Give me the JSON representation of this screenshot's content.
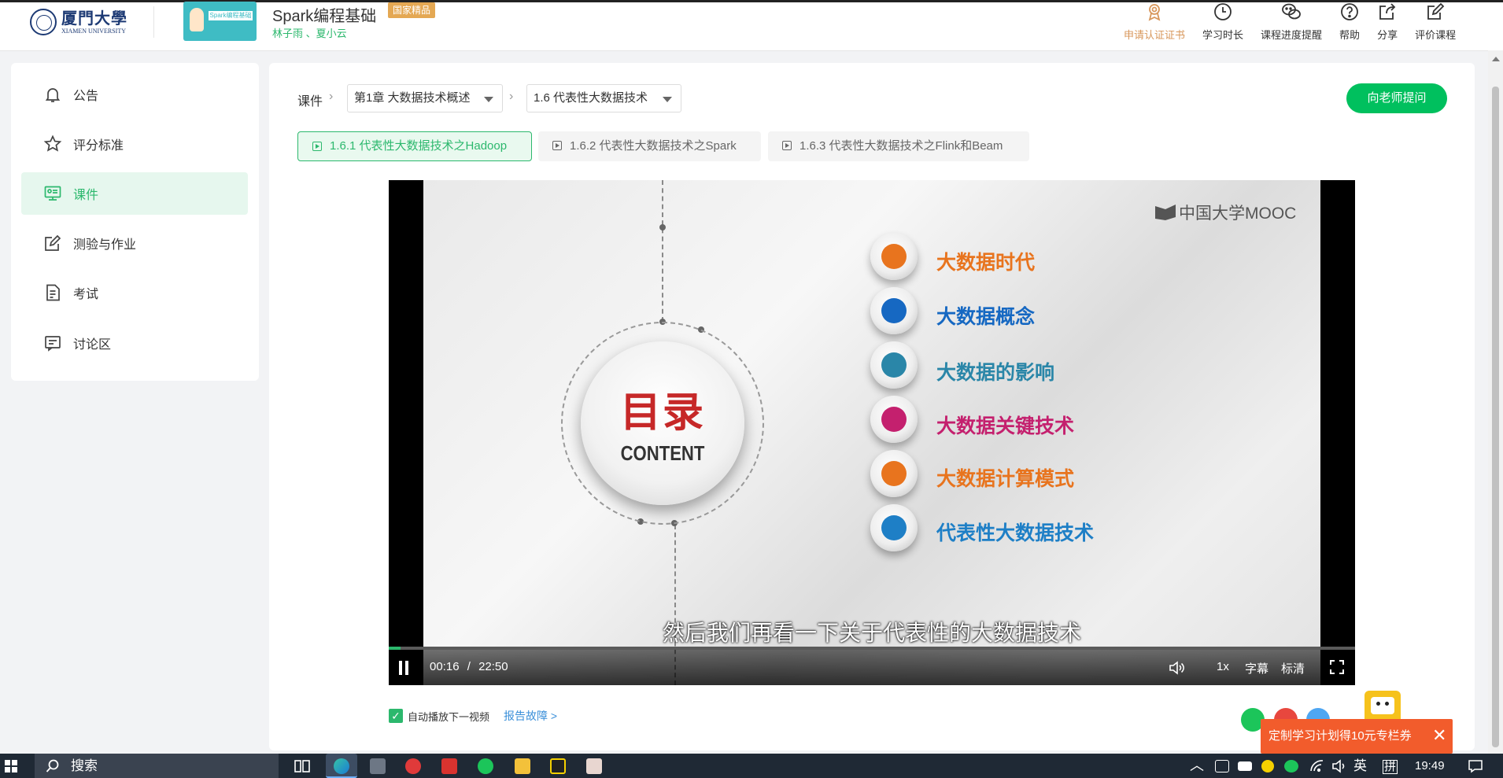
{
  "header": {
    "university_cn": "厦門大學",
    "university_en": "XIAMEN UNIVERSITY",
    "course_thumb_text": "Spark编程基础",
    "course_title": "Spark编程基础",
    "badge": "国家精品",
    "teachers": "林子雨 、夏小云",
    "actions": [
      {
        "label": "申请认证证书",
        "icon": "certificate-icon"
      },
      {
        "label": "学习时长",
        "icon": "clock-icon"
      },
      {
        "label": "课程进度提醒",
        "icon": "wechat-icon"
      },
      {
        "label": "帮助",
        "icon": "help-icon"
      },
      {
        "label": "分享",
        "icon": "share-icon"
      },
      {
        "label": "评价课程",
        "icon": "edit-icon"
      }
    ]
  },
  "sidebar": {
    "items": [
      {
        "label": "公告",
        "icon": "bell-icon"
      },
      {
        "label": "评分标准",
        "icon": "star-icon"
      },
      {
        "label": "课件",
        "icon": "courseware-icon",
        "active": true
      },
      {
        "label": "测验与作业",
        "icon": "quiz-icon"
      },
      {
        "label": "考试",
        "icon": "exam-icon"
      },
      {
        "label": "讨论区",
        "icon": "discussion-icon"
      }
    ]
  },
  "breadcrumb": {
    "root": "课件",
    "chapter": "第1章 大数据技术概述",
    "section": "1.6 代表性大数据技术"
  },
  "ask_button": "向老师提问",
  "sub_tabs": [
    {
      "label": "1.6.1 代表性大数据技术之Hadoop",
      "active": true
    },
    {
      "label": "1.6.2 代表性大数据技术之Spark",
      "active": false
    },
    {
      "label": "1.6.3 代表性大数据技术之Flink和Beam",
      "active": false
    }
  ],
  "video": {
    "watermark": "中国大学MOOC",
    "slide_title": "目录",
    "slide_subtitle": "CONTENT",
    "items": [
      {
        "text": "大数据时代",
        "color": "#e8741e"
      },
      {
        "text": "大数据概念",
        "color": "#1668c2"
      },
      {
        "text": "大数据的影响",
        "color": "#2a86a8"
      },
      {
        "text": "大数据关键技术",
        "color": "#c4206e"
      },
      {
        "text": "大数据计算模式",
        "color": "#e8741e"
      },
      {
        "text": "代表性大数据技术",
        "color": "#1e7fc6"
      }
    ],
    "subtitle": "然后我们再看一下关于代表性的大数据技术",
    "current_time": "00:16",
    "time_separator": "/",
    "duration": "22:50",
    "progress_fraction": 0.012,
    "speed": "1x",
    "captions_label": "字幕",
    "quality_label": "标清"
  },
  "below_video": {
    "autoplay_label": "自动播放下一视频",
    "report_label": "报告故障 >"
  },
  "promo": {
    "text": "定制学习计划得10元专栏券",
    "close": "✕"
  },
  "taskbar": {
    "search_label": "搜索",
    "ime_lang": "英",
    "ime_mode": "拼",
    "clock": "19:49"
  },
  "colors": {
    "accent": "#2cb86d",
    "ask_button": "#00c05e",
    "badge": "#e4a853",
    "promo": "#f25c2c",
    "cert": "#d8975b"
  }
}
